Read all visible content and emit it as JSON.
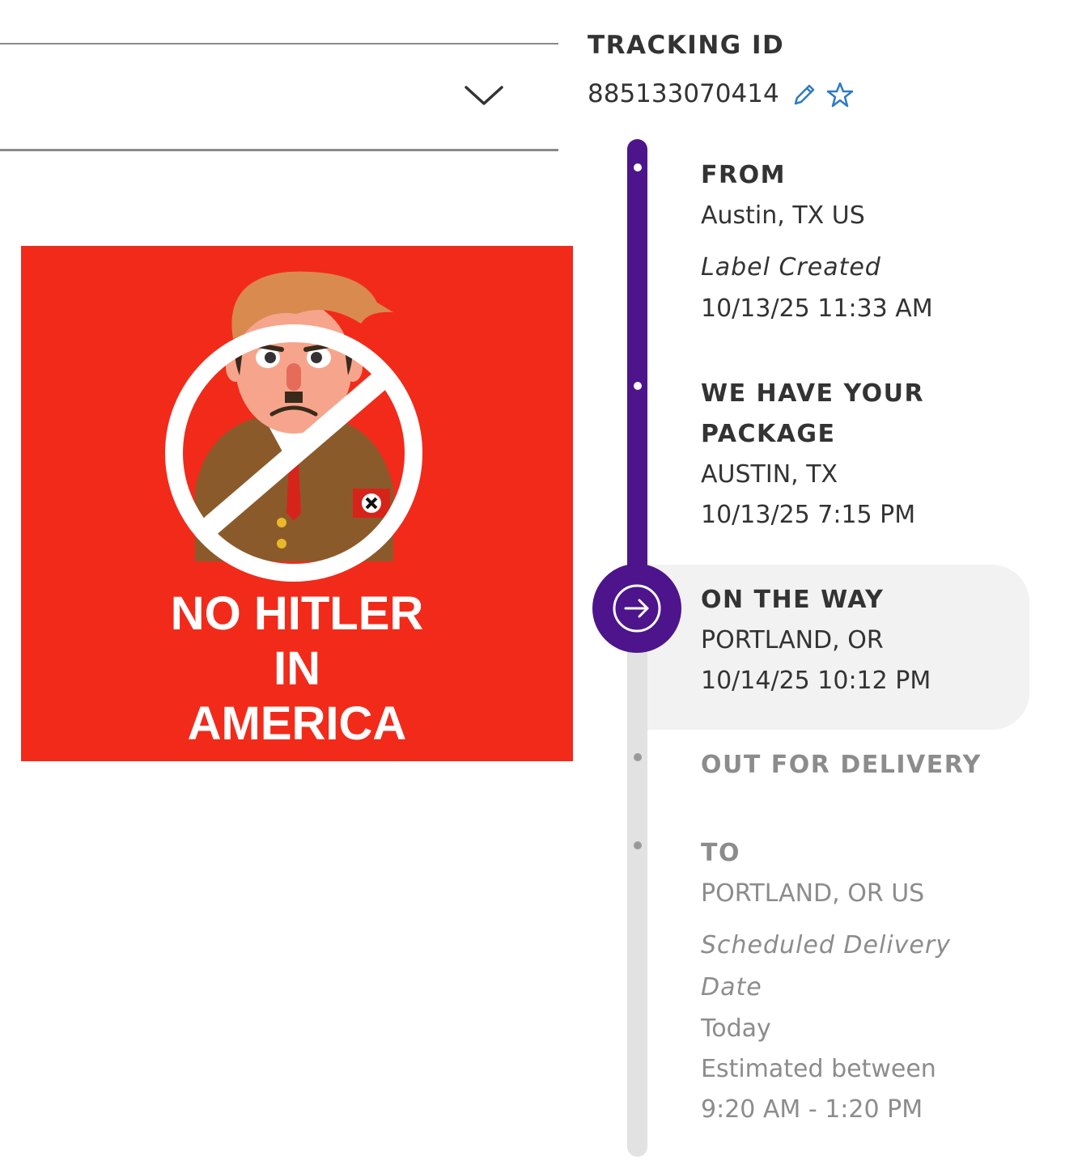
{
  "tracking": {
    "label": "TRACKING ID",
    "number": "885133070414",
    "edit_icon": "pencil-icon",
    "favorite_icon": "star-outline-icon"
  },
  "dropdown": {
    "icon": "chevron-down-icon"
  },
  "poster": {
    "lines": [
      "NO HITLER",
      "IN",
      "AMERICA"
    ],
    "background": "#f22a1a"
  },
  "colors": {
    "accent": "#4d148c",
    "pending_track": "#e2e2e2",
    "text_dark": "#333333",
    "text_muted": "#8c8c8c",
    "link_blue": "#2e7bc4"
  },
  "timeline": {
    "from": {
      "heading": "FROM",
      "location": "Austin, TX US",
      "status": "Label Created",
      "datetime": "10/13/25 11:33 AM"
    },
    "picked_up": {
      "heading_line1": "WE HAVE YOUR",
      "heading_line2": "PACKAGE",
      "location": "AUSTIN, TX",
      "datetime": "10/13/25 7:15 PM"
    },
    "on_the_way": {
      "heading": "ON THE WAY",
      "location": "PORTLAND, OR",
      "datetime": "10/14/25 10:12 PM",
      "icon": "arrow-right-circle-icon"
    },
    "out_for_delivery": {
      "heading": "OUT FOR DELIVERY"
    },
    "to": {
      "heading": "TO",
      "location": "PORTLAND, OR US",
      "status_line1": "Scheduled Delivery",
      "status_line2": "Date",
      "day": "Today",
      "window_label": "Estimated between",
      "window": "9:20 AM - 1:20 PM"
    }
  }
}
